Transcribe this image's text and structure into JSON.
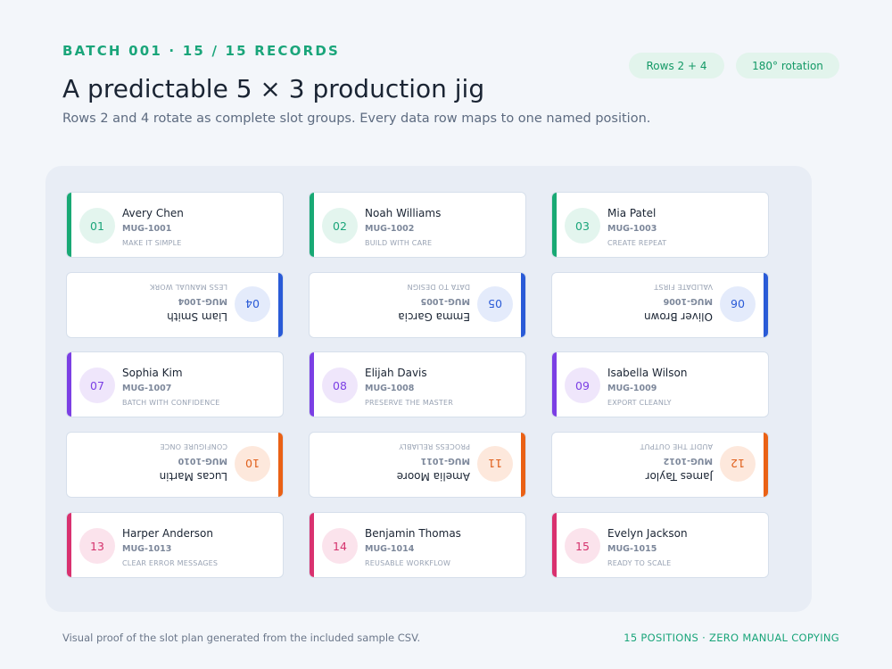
{
  "header": {
    "eyebrow": "BATCH 001 · 15 / 15 RECORDS",
    "title": "A predictable 5 × 3 production jig",
    "subtitle": "Rows 2 and 4 rotate as complete slot groups. Every data row maps to one named position.",
    "pills": [
      "Rows 2 + 4",
      "180° rotation"
    ]
  },
  "colors": {
    "green": "#18a974",
    "blue": "#2a5bd7",
    "purple": "#7b3fe4",
    "orange": "#ea6115",
    "pink": "#d9316f"
  },
  "rows": [
    {
      "color": "green",
      "rotated": false,
      "cards": [
        {
          "number": "01",
          "name": "Avery Chen",
          "code": "MUG-1001",
          "motto": "MAKE IT SIMPLE"
        },
        {
          "number": "02",
          "name": "Noah Williams",
          "code": "MUG-1002",
          "motto": "BUILD WITH CARE"
        },
        {
          "number": "03",
          "name": "Mia Patel",
          "code": "MUG-1003",
          "motto": "CREATE REPEAT"
        }
      ]
    },
    {
      "color": "blue",
      "rotated": true,
      "cards": [
        {
          "number": "04",
          "name": "Liam Smith",
          "code": "MUG-1004",
          "motto": "LESS MANUAL WORK"
        },
        {
          "number": "05",
          "name": "Emma Garcia",
          "code": "MUG-1005",
          "motto": "DATA TO DESIGN"
        },
        {
          "number": "06",
          "name": "Oliver Brown",
          "code": "MUG-1006",
          "motto": "VALIDATE FIRST"
        }
      ]
    },
    {
      "color": "purple",
      "rotated": false,
      "cards": [
        {
          "number": "07",
          "name": "Sophia Kim",
          "code": "MUG-1007",
          "motto": "BATCH WITH CONFIDENCE"
        },
        {
          "number": "08",
          "name": "Elijah Davis",
          "code": "MUG-1008",
          "motto": "PRESERVE THE MASTER"
        },
        {
          "number": "09",
          "name": "Isabella Wilson",
          "code": "MUG-1009",
          "motto": "EXPORT CLEANLY"
        }
      ]
    },
    {
      "color": "orange",
      "rotated": true,
      "cards": [
        {
          "number": "10",
          "name": "Lucas Martin",
          "code": "MUG-1010",
          "motto": "CONFIGURE ONCE"
        },
        {
          "number": "11",
          "name": "Amelia Moore",
          "code": "MUG-1011",
          "motto": "PROCESS RELIABLY"
        },
        {
          "number": "12",
          "name": "James Taylor",
          "code": "MUG-1012",
          "motto": "AUDIT THE OUTPUT"
        }
      ]
    },
    {
      "color": "pink",
      "rotated": false,
      "cards": [
        {
          "number": "13",
          "name": "Harper Anderson",
          "code": "MUG-1013",
          "motto": "CLEAR ERROR MESSAGES"
        },
        {
          "number": "14",
          "name": "Benjamin Thomas",
          "code": "MUG-1014",
          "motto": "REUSABLE WORKFLOW"
        },
        {
          "number": "15",
          "name": "Evelyn Jackson",
          "code": "MUG-1015",
          "motto": "READY TO SCALE"
        }
      ]
    }
  ],
  "footer": {
    "note": "Visual proof of the slot plan generated from the included sample CSV.",
    "summary": "15 POSITIONS · ZERO MANUAL COPYING"
  }
}
